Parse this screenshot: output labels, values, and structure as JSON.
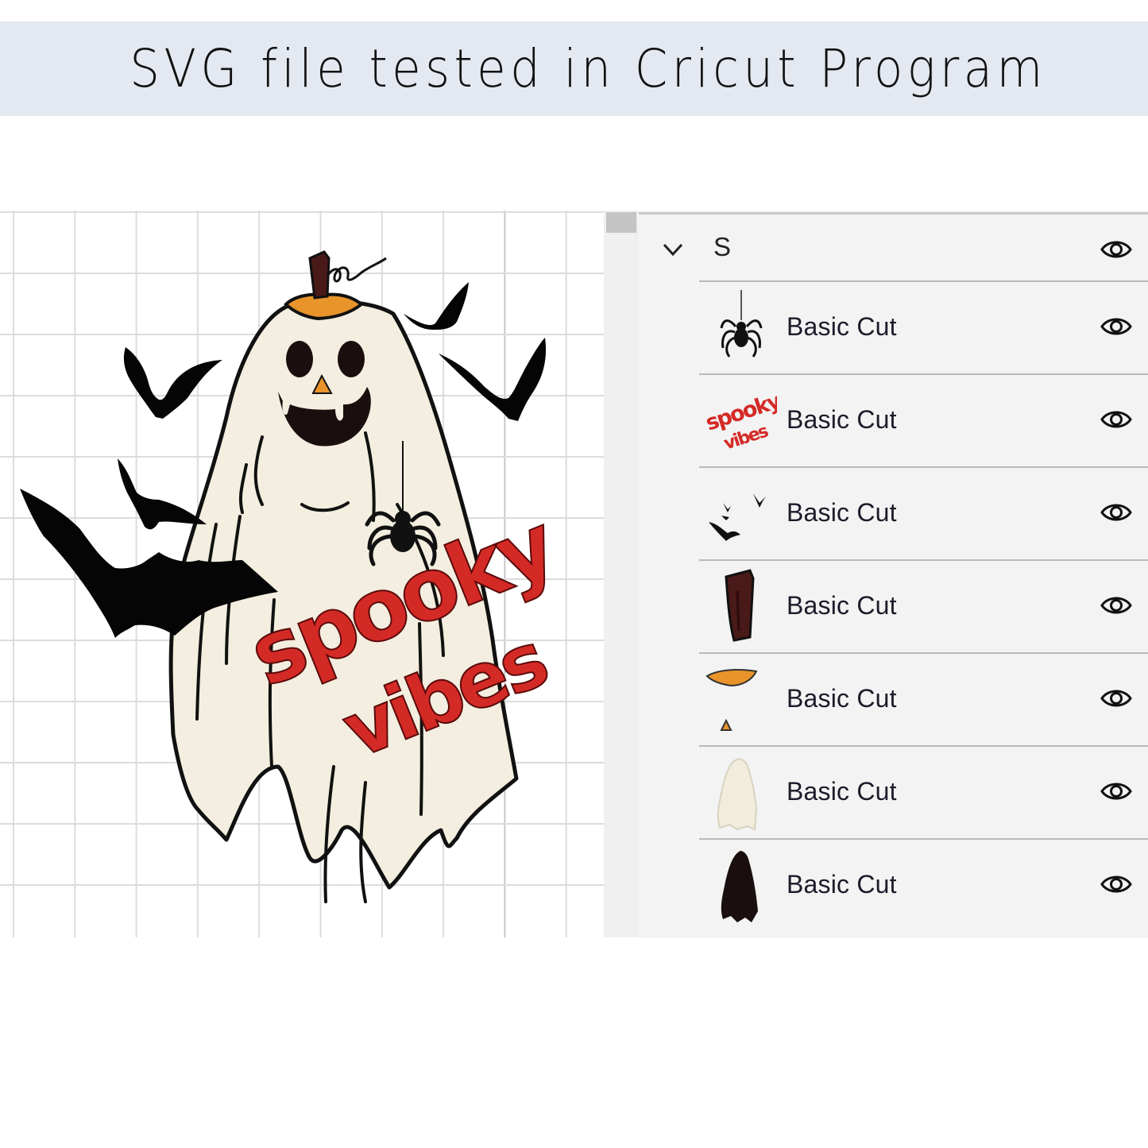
{
  "banner": {
    "title": "SVG file tested in Cricut Program"
  },
  "canvas": {
    "artwork_text": [
      "spooky",
      "vibes"
    ],
    "colors": {
      "ghost_fill": "#f3eedf",
      "outline": "#111111",
      "text_red": "#d42a26",
      "pumpkin_orange": "#e8942a",
      "stem_brown": "#4a1a18",
      "grid_line": "#dcdcdc"
    }
  },
  "layers_panel": {
    "group": {
      "label": "S",
      "expanded": true,
      "visibility_icon": "eye-icon"
    },
    "layers": [
      {
        "label": "Basic Cut",
        "thumbnail": "spider",
        "visibility_icon": "eye-icon"
      },
      {
        "label": "Basic Cut",
        "thumbnail": "spooky-vibes-text",
        "visibility_icon": "eye-icon"
      },
      {
        "label": "Basic Cut",
        "thumbnail": "bats",
        "visibility_icon": "eye-icon"
      },
      {
        "label": "Basic Cut",
        "thumbnail": "pumpkin-stem",
        "visibility_icon": "eye-icon"
      },
      {
        "label": "Basic Cut",
        "thumbnail": "pumpkin-top-and-nose",
        "visibility_icon": "eye-icon"
      },
      {
        "label": "Basic Cut",
        "thumbnail": "ghost-body",
        "visibility_icon": "eye-icon"
      },
      {
        "label": "Basic Cut",
        "thumbnail": "ghost-outline",
        "visibility_icon": "eye-icon"
      }
    ]
  }
}
